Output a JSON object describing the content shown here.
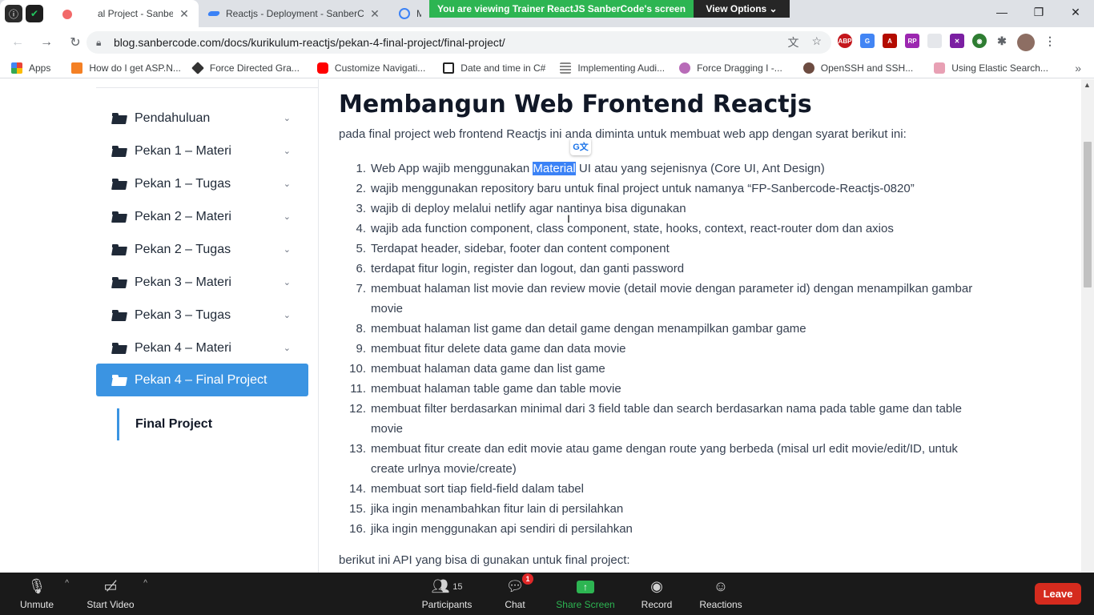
{
  "zoom_share": {
    "banner": "You are viewing Trainer ReactJS SanberCode's screen",
    "view_options": "View Options"
  },
  "tabs": [
    {
      "title": "al Project - SanberCode Blog",
      "close": "✕"
    },
    {
      "title": "Reactjs - Deployment - SanberCo",
      "close": "✕"
    },
    {
      "title": "Mo"
    }
  ],
  "window_controls": {
    "minimize": "—",
    "restore": "❐",
    "close": "✕"
  },
  "addressbar": {
    "url": "blog.sanbercode.com/docs/kurikulum-reactjs/pekan-4-final-project/final-project/"
  },
  "bookmarks": [
    {
      "label": "Apps",
      "color": "#ea4335"
    },
    {
      "label": "How do I get ASP.N...",
      "color": "#f48024"
    },
    {
      "label": "Force Directed Gra...",
      "color": "#333333"
    },
    {
      "label": "Customize Navigati...",
      "color": "#ff0000"
    },
    {
      "label": "Date and time in C#",
      "color": "#222222"
    },
    {
      "label": "Implementing Audi...",
      "color": "#888888"
    },
    {
      "label": "Force Dragging I -...",
      "color": "#b86bb8"
    },
    {
      "label": "OpenSSH and SSH...",
      "color": "#6d4c41"
    },
    {
      "label": "Using Elastic Search...",
      "color": "#e8a0b4"
    }
  ],
  "sidebar": {
    "items": [
      {
        "label": "Pendahuluan"
      },
      {
        "label": "Pekan 1 – Materi"
      },
      {
        "label": "Pekan 1 – Tugas"
      },
      {
        "label": "Pekan 2 – Materi"
      },
      {
        "label": "Pekan 2 – Tugas"
      },
      {
        "label": "Pekan 3 – Materi"
      },
      {
        "label": "Pekan 3 – Tugas"
      },
      {
        "label": "Pekan 4 – Materi"
      },
      {
        "label": "Pekan 4 – Final Project"
      }
    ],
    "active_index": 8,
    "sub_item": "Final Project"
  },
  "content": {
    "title": "Membangun Web Frontend Reactjs",
    "intro": "pada final project web frontend Reactjs ini anda diminta untuk membuat web app dengan syarat berikut ini:",
    "requirements": [
      {
        "num": "1.",
        "before": "Web App wajib menggunakan ",
        "highlight": "Material",
        "after": " UI atau yang sejenisnya (Core UI, Ant Design)"
      },
      {
        "num": "2.",
        "text": "wajib menggunakan repository baru untuk final project untuk namanya “FP-Sanbercode-Reactjs-0820”"
      },
      {
        "num": "3.",
        "text": "wajib di deploy melalui netlify agar nantinya bisa digunakan"
      },
      {
        "num": "4.",
        "text": "wajib ada function component, class component, state, hooks, context, react-router dom dan axios"
      },
      {
        "num": "5.",
        "text": "Terdapat header, sidebar, footer dan content component"
      },
      {
        "num": "6.",
        "text": "terdapat fitur login, register dan logout, dan ganti password"
      },
      {
        "num": "7.",
        "text": "membuat halaman list movie dan review movie (detail movie dengan parameter id) dengan menampilkan gambar movie"
      },
      {
        "num": "8.",
        "text": "membuat halaman list game dan detail game dengan menampilkan gambar game"
      },
      {
        "num": "9.",
        "text": "membuat fitur delete data game dan data movie"
      },
      {
        "num": "10.",
        "text": "membuat halaman data game dan list game"
      },
      {
        "num": "11.",
        "text": "membuat halaman table game dan table movie"
      },
      {
        "num": "12.",
        "text": "membuat filter berdasarkan minimal dari 3 field table dan search berdasarkan nama pada table game dan table movie"
      },
      {
        "num": "13.",
        "text": "membuat fitur create dan edit movie atau game dengan route yang berbeda (misal url edit movie/edit/ID, untuk create urlnya movie/create)"
      },
      {
        "num": "14.",
        "text": "membuat sort tiap field-field dalam tabel"
      },
      {
        "num": "15.",
        "text": "jika ingin menambahkan fitur lain di persilahkan"
      },
      {
        "num": "16.",
        "text": "jika ingin menggunakan api sendiri di persilahkan"
      }
    ],
    "api_line": "berikut ini API yang bisa di gunakan untuk final project:"
  },
  "zoom_bar": {
    "unmute": "Unmute",
    "start_video": "Start Video",
    "participants": "Participants",
    "participants_count": "15",
    "chat": "Chat",
    "chat_badge": "1",
    "share_screen": "Share Screen",
    "record": "Record",
    "reactions": "Reactions",
    "leave": "Leave"
  }
}
